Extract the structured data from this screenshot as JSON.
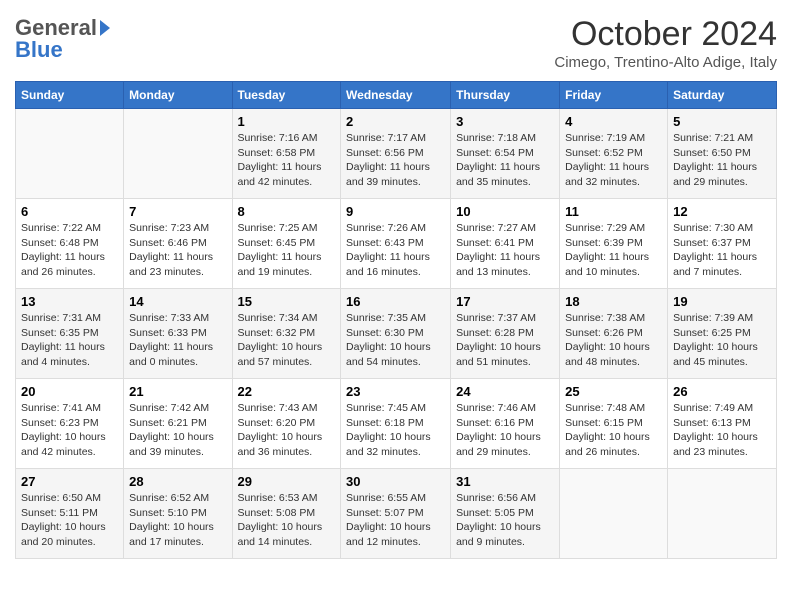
{
  "header": {
    "logo_line1_general": "General",
    "logo_line2_blue": "Blue",
    "month_year": "October 2024",
    "location": "Cimego, Trentino-Alto Adige, Italy"
  },
  "days_of_week": [
    "Sunday",
    "Monday",
    "Tuesday",
    "Wednesday",
    "Thursday",
    "Friday",
    "Saturday"
  ],
  "weeks": [
    [
      {
        "day": "",
        "info": ""
      },
      {
        "day": "",
        "info": ""
      },
      {
        "day": "1",
        "info": "Sunrise: 7:16 AM\nSunset: 6:58 PM\nDaylight: 11 hours and 42 minutes."
      },
      {
        "day": "2",
        "info": "Sunrise: 7:17 AM\nSunset: 6:56 PM\nDaylight: 11 hours and 39 minutes."
      },
      {
        "day": "3",
        "info": "Sunrise: 7:18 AM\nSunset: 6:54 PM\nDaylight: 11 hours and 35 minutes."
      },
      {
        "day": "4",
        "info": "Sunrise: 7:19 AM\nSunset: 6:52 PM\nDaylight: 11 hours and 32 minutes."
      },
      {
        "day": "5",
        "info": "Sunrise: 7:21 AM\nSunset: 6:50 PM\nDaylight: 11 hours and 29 minutes."
      }
    ],
    [
      {
        "day": "6",
        "info": "Sunrise: 7:22 AM\nSunset: 6:48 PM\nDaylight: 11 hours and 26 minutes."
      },
      {
        "day": "7",
        "info": "Sunrise: 7:23 AM\nSunset: 6:46 PM\nDaylight: 11 hours and 23 minutes."
      },
      {
        "day": "8",
        "info": "Sunrise: 7:25 AM\nSunset: 6:45 PM\nDaylight: 11 hours and 19 minutes."
      },
      {
        "day": "9",
        "info": "Sunrise: 7:26 AM\nSunset: 6:43 PM\nDaylight: 11 hours and 16 minutes."
      },
      {
        "day": "10",
        "info": "Sunrise: 7:27 AM\nSunset: 6:41 PM\nDaylight: 11 hours and 13 minutes."
      },
      {
        "day": "11",
        "info": "Sunrise: 7:29 AM\nSunset: 6:39 PM\nDaylight: 11 hours and 10 minutes."
      },
      {
        "day": "12",
        "info": "Sunrise: 7:30 AM\nSunset: 6:37 PM\nDaylight: 11 hours and 7 minutes."
      }
    ],
    [
      {
        "day": "13",
        "info": "Sunrise: 7:31 AM\nSunset: 6:35 PM\nDaylight: 11 hours and 4 minutes."
      },
      {
        "day": "14",
        "info": "Sunrise: 7:33 AM\nSunset: 6:33 PM\nDaylight: 11 hours and 0 minutes."
      },
      {
        "day": "15",
        "info": "Sunrise: 7:34 AM\nSunset: 6:32 PM\nDaylight: 10 hours and 57 minutes."
      },
      {
        "day": "16",
        "info": "Sunrise: 7:35 AM\nSunset: 6:30 PM\nDaylight: 10 hours and 54 minutes."
      },
      {
        "day": "17",
        "info": "Sunrise: 7:37 AM\nSunset: 6:28 PM\nDaylight: 10 hours and 51 minutes."
      },
      {
        "day": "18",
        "info": "Sunrise: 7:38 AM\nSunset: 6:26 PM\nDaylight: 10 hours and 48 minutes."
      },
      {
        "day": "19",
        "info": "Sunrise: 7:39 AM\nSunset: 6:25 PM\nDaylight: 10 hours and 45 minutes."
      }
    ],
    [
      {
        "day": "20",
        "info": "Sunrise: 7:41 AM\nSunset: 6:23 PM\nDaylight: 10 hours and 42 minutes."
      },
      {
        "day": "21",
        "info": "Sunrise: 7:42 AM\nSunset: 6:21 PM\nDaylight: 10 hours and 39 minutes."
      },
      {
        "day": "22",
        "info": "Sunrise: 7:43 AM\nSunset: 6:20 PM\nDaylight: 10 hours and 36 minutes."
      },
      {
        "day": "23",
        "info": "Sunrise: 7:45 AM\nSunset: 6:18 PM\nDaylight: 10 hours and 32 minutes."
      },
      {
        "day": "24",
        "info": "Sunrise: 7:46 AM\nSunset: 6:16 PM\nDaylight: 10 hours and 29 minutes."
      },
      {
        "day": "25",
        "info": "Sunrise: 7:48 AM\nSunset: 6:15 PM\nDaylight: 10 hours and 26 minutes."
      },
      {
        "day": "26",
        "info": "Sunrise: 7:49 AM\nSunset: 6:13 PM\nDaylight: 10 hours and 23 minutes."
      }
    ],
    [
      {
        "day": "27",
        "info": "Sunrise: 6:50 AM\nSunset: 5:11 PM\nDaylight: 10 hours and 20 minutes."
      },
      {
        "day": "28",
        "info": "Sunrise: 6:52 AM\nSunset: 5:10 PM\nDaylight: 10 hours and 17 minutes."
      },
      {
        "day": "29",
        "info": "Sunrise: 6:53 AM\nSunset: 5:08 PM\nDaylight: 10 hours and 14 minutes."
      },
      {
        "day": "30",
        "info": "Sunrise: 6:55 AM\nSunset: 5:07 PM\nDaylight: 10 hours and 12 minutes."
      },
      {
        "day": "31",
        "info": "Sunrise: 6:56 AM\nSunset: 5:05 PM\nDaylight: 10 hours and 9 minutes."
      },
      {
        "day": "",
        "info": ""
      },
      {
        "day": "",
        "info": ""
      }
    ]
  ]
}
